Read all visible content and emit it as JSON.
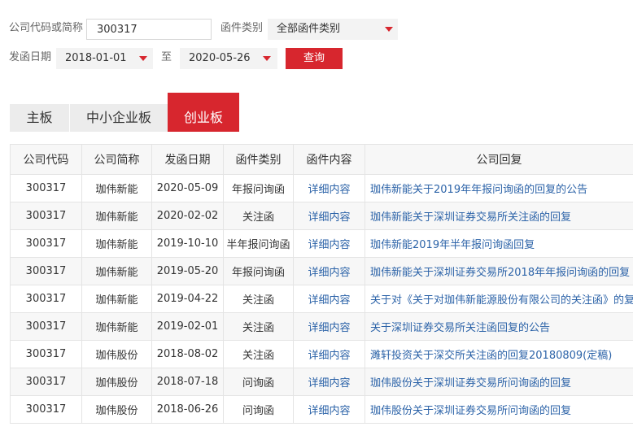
{
  "filters": {
    "code_label": "公司代码或简称",
    "code_value": "300317",
    "type_label": "函件类别",
    "type_value": "全部函件类别",
    "date_label": "发函日期",
    "date_from": "2018-01-01",
    "date_sep": "至",
    "date_to": "2020-05-26",
    "query_label": "查询"
  },
  "tabs": [
    "主板",
    "中小企业板",
    "创业板"
  ],
  "active_tab": 2,
  "table": {
    "headers": [
      "公司代码",
      "公司简称",
      "发函日期",
      "函件类别",
      "函件内容",
      "公司回复"
    ],
    "rows": [
      [
        "300317",
        "珈伟新能",
        "2020-05-09",
        "年报问询函",
        "详细内容",
        "珈伟新能关于2019年年报问询函的回复的公告"
      ],
      [
        "300317",
        "珈伟新能",
        "2020-02-02",
        "关注函",
        "详细内容",
        "珈伟新能关于深圳证券交易所关注函的回复"
      ],
      [
        "300317",
        "珈伟新能",
        "2019-10-10",
        "半年报问询函",
        "详细内容",
        "珈伟新能2019年半年报问询函回复"
      ],
      [
        "300317",
        "珈伟新能",
        "2019-05-20",
        "年报问询函",
        "详细内容",
        "珈伟新能关于深圳证券交易所2018年年报问询函的回复"
      ],
      [
        "300317",
        "珈伟新能",
        "2019-04-22",
        "关注函",
        "详细内容",
        "关于对《关于对珈伟新能源股份有限公司的关注函》的复函"
      ],
      [
        "300317",
        "珈伟新能",
        "2019-02-01",
        "关注函",
        "详细内容",
        "关于深圳证券交易所关注函回复的公告"
      ],
      [
        "300317",
        "珈伟股份",
        "2018-08-02",
        "关注函",
        "详细内容",
        "濉轩投资关于深交所关注函的回复20180809(定稿)"
      ],
      [
        "300317",
        "珈伟股份",
        "2018-07-18",
        "问询函",
        "详细内容",
        "珈伟股份关于深圳证券交易所问询函的回复"
      ],
      [
        "300317",
        "珈伟股份",
        "2018-06-26",
        "问询函",
        "详细内容",
        "珈伟股份关于深圳证券交易所问询函的回复"
      ]
    ]
  },
  "colors": {
    "accent": "#d7262e",
    "link": "#2c63a8",
    "header_bg": "#f7f7f7",
    "tab_bg": "#ececec"
  },
  "icons": {
    "dropdown": "dropdown-triangle-icon"
  }
}
